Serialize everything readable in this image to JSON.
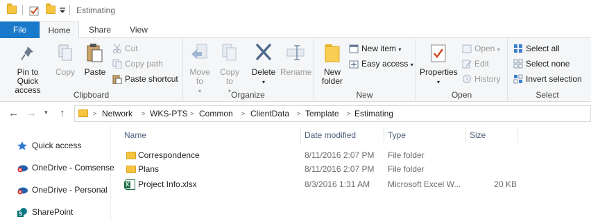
{
  "window": {
    "title": "Estimating"
  },
  "tabs": [
    {
      "label": "File"
    },
    {
      "label": "Home"
    },
    {
      "label": "Share"
    },
    {
      "label": "View"
    }
  ],
  "ribbon": {
    "clipboard": {
      "label": "Clipboard",
      "pin": "Pin to Quick access",
      "copy": "Copy",
      "paste": "Paste",
      "cut": "Cut",
      "copy_path": "Copy path",
      "paste_shortcut": "Paste shortcut"
    },
    "organize": {
      "label": "Organize",
      "move_to": "Move to",
      "copy_to": "Copy to",
      "delete": "Delete",
      "rename": "Rename"
    },
    "new": {
      "label": "New",
      "new_folder": "New folder",
      "new_item": "New item",
      "easy_access": "Easy access"
    },
    "open": {
      "label": "Open",
      "properties": "Properties",
      "open": "Open",
      "edit": "Edit",
      "history": "History"
    },
    "select": {
      "label": "Select",
      "select_all": "Select all",
      "select_none": "Select none",
      "invert_selection": "Invert selection"
    }
  },
  "address": {
    "crumbs": [
      "Network",
      "WKS-PTS",
      "Common",
      "ClientData",
      "Template",
      "Estimating"
    ]
  },
  "navpane": {
    "items": [
      {
        "label": "Quick access",
        "icon": "star-icon"
      },
      {
        "label": "OneDrive - Comsense",
        "icon": "onedrive-business-icon"
      },
      {
        "label": "OneDrive - Personal",
        "icon": "onedrive-personal-icon"
      },
      {
        "label": "SharePoint",
        "icon": "sharepoint-icon"
      }
    ]
  },
  "filelist": {
    "columns": {
      "name": "Name",
      "date": "Date modified",
      "type": "Type",
      "size": "Size"
    },
    "rows": [
      {
        "name": "Correspondence",
        "date": "8/11/2016 2:07 PM",
        "type": "File folder",
        "size": "",
        "icon": "folder-icon"
      },
      {
        "name": "Plans",
        "date": "8/11/2016 2:07 PM",
        "type": "File folder",
        "size": "",
        "icon": "folder-icon"
      },
      {
        "name": "Project Info.xlsx",
        "date": "8/3/2016 1:31 AM",
        "type": "Microsoft Excel W...",
        "size": "20 KB",
        "icon": "excel-file-icon"
      }
    ]
  },
  "colors": {
    "file_tab": "#1979ca",
    "folder": "#f5c542",
    "excel": "#1e7145",
    "ribbon_bg": "#f5f6f7",
    "header_text": "#4c607a"
  }
}
